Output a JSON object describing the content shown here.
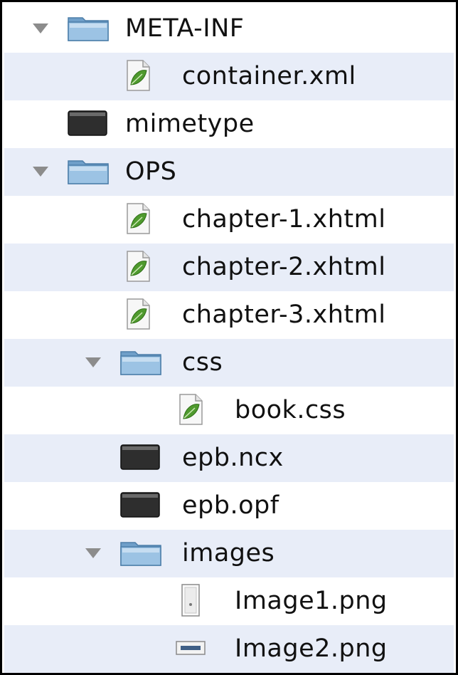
{
  "tree": [
    {
      "name": "META-INF",
      "kind": "folder",
      "depth": 0,
      "expanded": true,
      "icon": "folder-icon"
    },
    {
      "name": "container.xml",
      "kind": "xml",
      "depth": 1,
      "icon": "leaf-document-icon"
    },
    {
      "name": "mimetype",
      "kind": "binary",
      "depth": 0,
      "icon": "terminal-document-icon"
    },
    {
      "name": "OPS",
      "kind": "folder",
      "depth": 0,
      "expanded": true,
      "icon": "folder-icon"
    },
    {
      "name": "chapter-1.xhtml",
      "kind": "xml",
      "depth": 1,
      "icon": "leaf-document-icon"
    },
    {
      "name": "chapter-2.xhtml",
      "kind": "xml",
      "depth": 1,
      "icon": "leaf-document-icon"
    },
    {
      "name": "chapter-3.xhtml",
      "kind": "xml",
      "depth": 1,
      "icon": "leaf-document-icon"
    },
    {
      "name": "css",
      "kind": "folder",
      "depth": 1,
      "expanded": true,
      "icon": "folder-icon"
    },
    {
      "name": "book.css",
      "kind": "xml",
      "depth": 2,
      "icon": "leaf-document-icon"
    },
    {
      "name": "epb.ncx",
      "kind": "binary",
      "depth": 1,
      "icon": "terminal-document-icon"
    },
    {
      "name": "epb.opf",
      "kind": "binary",
      "depth": 1,
      "icon": "terminal-document-icon"
    },
    {
      "name": "images",
      "kind": "folder",
      "depth": 1,
      "expanded": true,
      "icon": "folder-icon"
    },
    {
      "name": "Image1.png",
      "kind": "image-portrait",
      "depth": 2,
      "icon": "portrait-image-icon"
    },
    {
      "name": "Image2.png",
      "kind": "image-landscape",
      "depth": 2,
      "icon": "landscape-image-icon"
    }
  ],
  "colors": {
    "row_alt": "#e8edf8",
    "folder": "#8fb7da",
    "leaf": "#4f9a2e",
    "triangle": "#8c8c8c"
  }
}
